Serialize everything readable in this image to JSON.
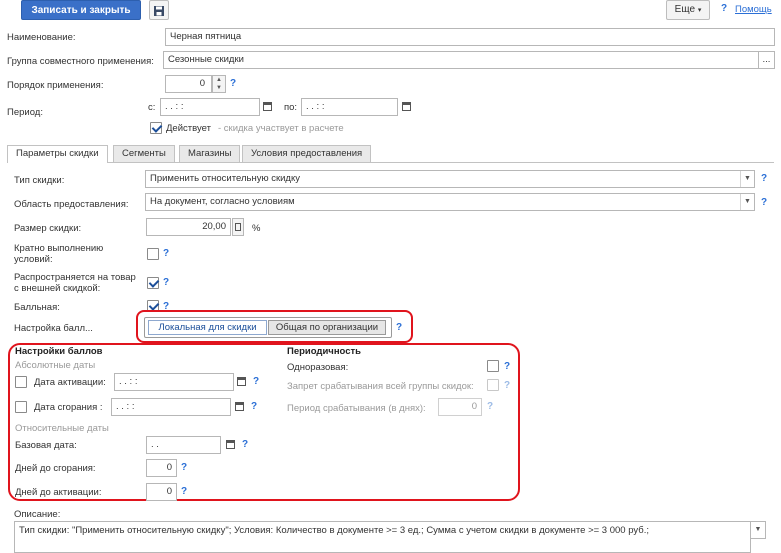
{
  "toolbar": {
    "save_close": "Записать и закрыть",
    "more": "Еще",
    "help": "Помощь"
  },
  "form": {
    "name_label": "Наименование:",
    "name_value": "Черная пятница",
    "group_label": "Группа совместного применения:",
    "group_value": "Сезонные скидки",
    "group_btn": "...",
    "order_label": "Порядок применения:",
    "order_value": "0",
    "period_label": "Период:",
    "from_label": "с:",
    "from_value": " .  .       :  :",
    "to_label": "по:",
    "to_value": " .  .       :  :",
    "active_label": "Действует",
    "active_hint": "- скидка участвует в расчете"
  },
  "tabs": [
    "Параметры скидки",
    "Сегменты",
    "Магазины",
    "Условия предоставления"
  ],
  "params": {
    "type_label": "Тип скидки:",
    "type_value": "Применить относительную скидку",
    "area_label": "Область предоставления:",
    "area_value": "На документ, согласно условиям",
    "size_label": "Размер скидки:",
    "size_value": "20,00",
    "size_unit": "%",
    "multiple_label_1": "Кратно выполнению",
    "multiple_label_2": "условий:",
    "ext_label_1": "Распространяется на товар",
    "ext_label_2": "с внешней скидкой:",
    "points_label": "Балльная:",
    "points_setting_label": "Настройка балл...",
    "toggle_local": "Локальная для скидки",
    "toggle_org": "Общая по организации"
  },
  "points": {
    "header": "Настройки баллов",
    "absolute": "Абсолютные даты",
    "activation_label": "Дата активации:",
    "activation_value": " .  .       :  :",
    "burn_label": "Дата сгорания :",
    "burn_value": " .  .       :  :",
    "relative": "Относительные даты",
    "base_label": "Базовая дата:",
    "base_value": " .  .",
    "days_burn_label": "Дней до сгорания:",
    "days_burn_value": "0",
    "days_act_label": "Дней до активации:",
    "days_act_value": "0"
  },
  "periodicity": {
    "header": "Периодичность",
    "onetime_label": "Одноразовая:",
    "block_label": "Запрет срабатывания всей группы скидок:",
    "period_label": "Период срабатывания (в днях):",
    "period_value": "0"
  },
  "description": {
    "label": "Описание:",
    "text": "Тип скидки: \"Применить относительную скидку\"; Условия: Количество в документе >= 3 ед.; Сумма с учетом скидки в документе >= 3 000 руб.;"
  },
  "help_mark": "?"
}
